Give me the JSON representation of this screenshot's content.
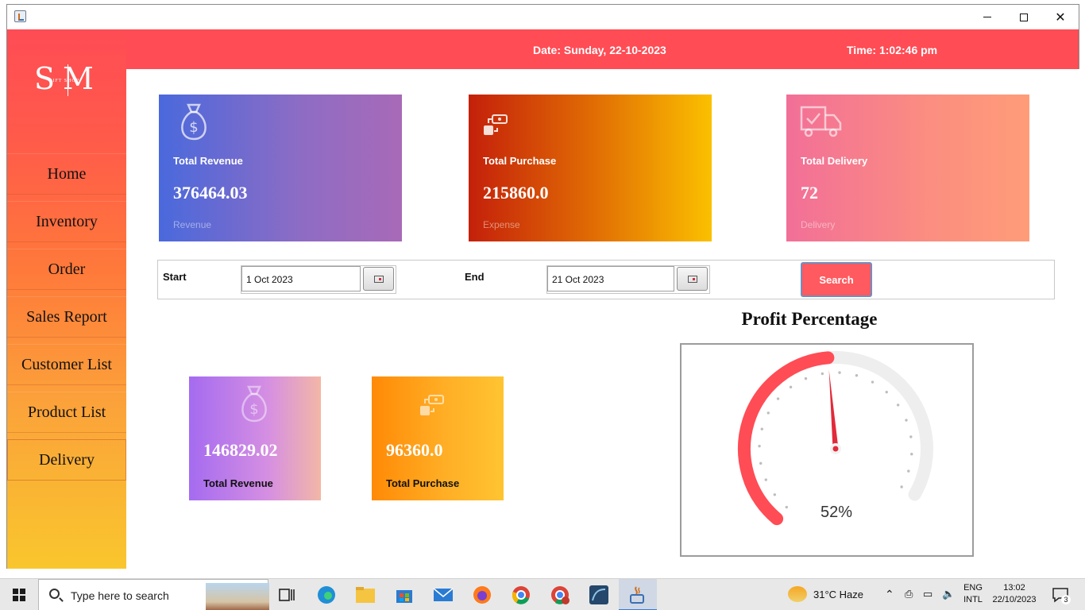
{
  "header": {
    "date": "Date: Sunday, 22-10-2023",
    "time": "Time: 1:02:46 pm"
  },
  "logo": {
    "letters": "SM",
    "subtitle": "GIFT SHOP"
  },
  "sidebar": {
    "items": [
      {
        "label": "Home"
      },
      {
        "label": "Inventory"
      },
      {
        "label": "Order"
      },
      {
        "label": "Sales Report"
      },
      {
        "label": "Customer List"
      },
      {
        "label": "Product List"
      },
      {
        "label": "Delivery"
      }
    ]
  },
  "cards": {
    "revenue": {
      "title": "Total Revenue",
      "value": "376464.03",
      "sub": "Revenue",
      "icon": "money-bag-icon"
    },
    "purchase": {
      "title": "Total Purchase",
      "value": "215860.0",
      "sub": "Expense",
      "icon": "money-transfer-icon"
    },
    "delivery": {
      "title": "Total Delivery",
      "value": "72",
      "sub": "Delivery",
      "icon": "delivery-truck-icon"
    }
  },
  "filter": {
    "start_label": "Start",
    "start_value": "1 Oct 2023",
    "end_label": "End",
    "end_value": "21 Oct 2023",
    "search_label": "Search"
  },
  "summary": {
    "revenue": {
      "value": "146829.02",
      "title": "Total Revenue"
    },
    "purchase": {
      "value": "96360.0",
      "title": "Total Purchase"
    }
  },
  "profit": {
    "title": "Profit Percentage",
    "value_text": "52%",
    "percent": 52
  },
  "taskbar": {
    "search_placeholder": "Type here to search",
    "weather": "31°C  Haze",
    "lang_top": "ENG",
    "lang_bottom": "INTL",
    "clock_time": "13:02",
    "clock_date": "22/10/2023",
    "notifications": "3"
  },
  "colors": {
    "accent": "#ff4c55",
    "gauge_fill": "#ff4c55",
    "gauge_track": "#eeeeee"
  }
}
